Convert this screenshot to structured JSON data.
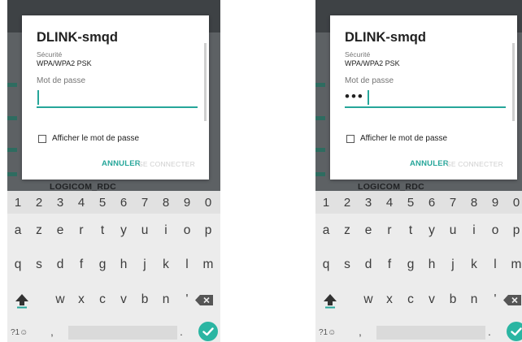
{
  "screens": [
    {
      "dialog": {
        "title": "DLINK-smqd",
        "security_label": "Sécurité",
        "security_value": "WPA/WPA2 PSK",
        "password_label": "Mot de passe",
        "password_masked": "",
        "show_password_label": "Afficher le mot de passe",
        "show_password_checked": false,
        "cancel_label": "ANNULER",
        "connect_label": "SE CONNECTER",
        "connect_enabled": false
      },
      "background_ssid": "LOGICOM_RDC"
    },
    {
      "dialog": {
        "title": "DLINK-smqd",
        "security_label": "Sécurité",
        "security_value": "WPA/WPA2 PSK",
        "password_label": "Mot de passe",
        "password_masked": "•••",
        "show_password_label": "Afficher le mot de passe",
        "show_password_checked": false,
        "cancel_label": "ANNULER",
        "connect_label": "SE CONNECTER",
        "connect_enabled": false
      },
      "background_ssid": "LOGICOM_RDC"
    }
  ],
  "keyboard": {
    "numbers": [
      "1",
      "2",
      "3",
      "4",
      "5",
      "6",
      "7",
      "8",
      "9",
      "0"
    ],
    "row1": [
      "a",
      "z",
      "e",
      "r",
      "t",
      "y",
      "u",
      "i",
      "o",
      "p"
    ],
    "row2": [
      "q",
      "s",
      "d",
      "f",
      "g",
      "h",
      "j",
      "k",
      "l",
      "m"
    ],
    "row3": [
      "w",
      "x",
      "c",
      "v",
      "b",
      "n",
      "'"
    ],
    "symbols_key": "?1☺",
    "comma": ",",
    "period": "."
  },
  "colors": {
    "accent": "#26a69a",
    "enter_key": "#2bb5a2",
    "disabled_text": "#cfcfcf",
    "dim_background": "#5d6164"
  },
  "icons": [
    "shift-icon",
    "backspace-icon",
    "checkmark-icon",
    "checkbox-icon"
  ]
}
